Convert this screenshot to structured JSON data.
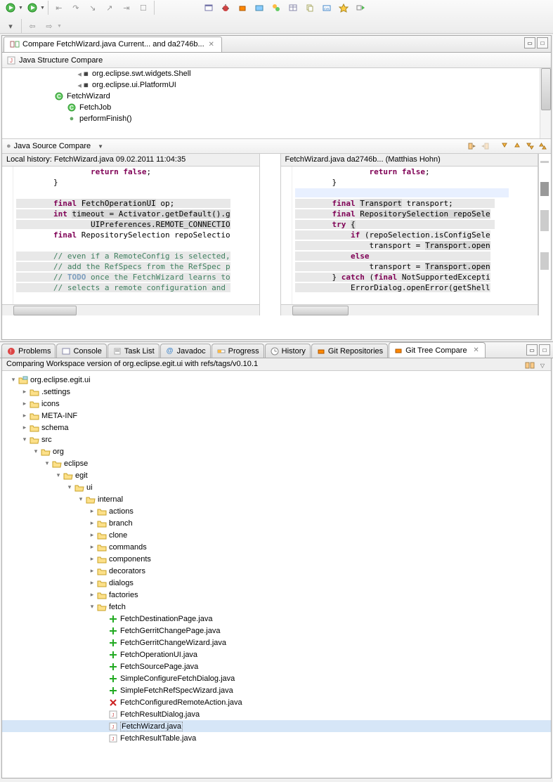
{
  "toolbar": {},
  "editor": {
    "tab_title": "Compare FetchWizard.java Current... and da2746b..."
  },
  "structure": {
    "title": "Java Structure Compare",
    "items": [
      "org.eclipse.swt.widgets.Shell",
      "org.eclipse.ui.PlatformUI",
      "FetchWizard",
      "FetchJob",
      "performFinish()"
    ]
  },
  "source": {
    "title": "Java Source Compare",
    "left_title": "Local history: FetchWizard.java 09.02.2011 11:04:35",
    "right_title": "FetchWizard.java da2746b... (Matthias Hohn)"
  },
  "tabs": {
    "problems": "Problems",
    "console": "Console",
    "tasklist": "Task List",
    "javadoc": "Javadoc",
    "progress": "Progress",
    "history": "History",
    "gitrepos": "Git Repositories",
    "gittree": "Git Tree Compare"
  },
  "tree_compare": {
    "header": "Comparing Workspace version of org.eclipse.egit.ui with refs/tags/v0.10.1",
    "root": "org.eclipse.egit.ui",
    "folders_top": [
      ".settings",
      "icons",
      "META-INF",
      "schema"
    ],
    "src": "src",
    "org": "org",
    "eclipse": "eclipse",
    "egit": "egit",
    "ui": "ui",
    "internal": "internal",
    "internal_folders": [
      "actions",
      "branch",
      "clone",
      "commands",
      "components",
      "decorators",
      "dialogs",
      "factories"
    ],
    "fetch": "fetch",
    "fetch_files": [
      {
        "name": "FetchDestinationPage.java",
        "status": "add"
      },
      {
        "name": "FetchGerritChangePage.java",
        "status": "add"
      },
      {
        "name": "FetchGerritChangeWizard.java",
        "status": "add"
      },
      {
        "name": "FetchOperationUI.java",
        "status": "add"
      },
      {
        "name": "FetchSourcePage.java",
        "status": "add"
      },
      {
        "name": "SimpleConfigureFetchDialog.java",
        "status": "add"
      },
      {
        "name": "SimpleFetchRefSpecWizard.java",
        "status": "add"
      },
      {
        "name": "FetchConfiguredRemoteAction.java",
        "status": "del"
      },
      {
        "name": "FetchResultDialog.java",
        "status": "mod"
      },
      {
        "name": "FetchWizard.java",
        "status": "mod",
        "selected": true
      },
      {
        "name": "FetchResultTable.java",
        "status": "mod"
      }
    ]
  }
}
